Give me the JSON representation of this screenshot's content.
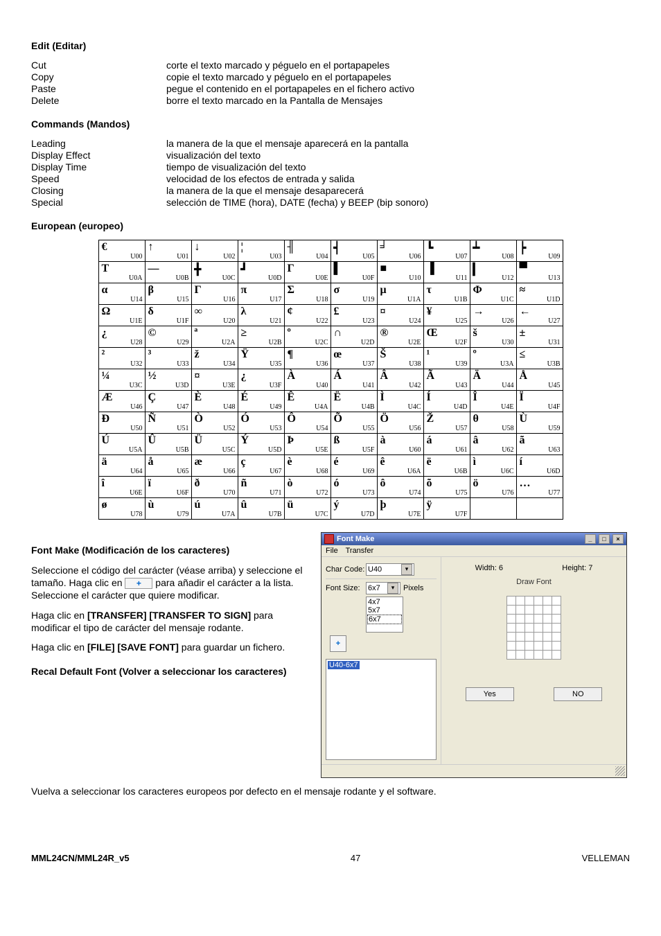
{
  "sections": {
    "edit": {
      "title": "Edit (Editar)",
      "items": [
        {
          "term": "Cut",
          "desc": "corte el texto marcado y péguelo en el portapapeles"
        },
        {
          "term": "Copy",
          "desc": "copie el texto marcado y péguelo en el portapapeles"
        },
        {
          "term": "Paste",
          "desc": "pegue el contenido en el portapapeles en el fichero activo"
        },
        {
          "term": "Delete",
          "desc": "borre el texto marcado en la Pantalla de Mensajes"
        }
      ]
    },
    "commands": {
      "title": "Commands (Mandos)",
      "items": [
        {
          "term": "Leading",
          "desc": "la manera de la que el mensaje aparecerá en la pantalla"
        },
        {
          "term": "Display Effect",
          "desc": "visualización del texto"
        },
        {
          "term": "Display Time",
          "desc": "tiempo de visualización del texto"
        },
        {
          "term": "Speed",
          "desc": "velocidad de los efectos de entrada y salida"
        },
        {
          "term": "Closing",
          "desc": "la manera de la que el mensaje desaparecerá"
        },
        {
          "term": "Special",
          "desc": "selección de TIME (hora), DATE (fecha) y BEEP (bip sonoro)"
        }
      ]
    },
    "european": {
      "title": "European (europeo)"
    },
    "fontmake": {
      "title": "Font Make (Modificación de los caracteres)",
      "p1a": "Seleccione el código del carácter (véase arriba) y seleccione el tamaño. Haga clic en ",
      "p1b": " para añadir el carácter a la lista. Seleccione el carácter que quiere modificar.",
      "p2a": "Haga clic en ",
      "p2b": "[TRANSFER] [TRANSFER TO SIGN]",
      "p2c": " para modificar el tipo de carácter del mensaje rodante.",
      "p3a": "Haga clic en ",
      "p3b": "[FILE] [SAVE FONT]",
      "p3c": " para guardar un fichero.",
      "recal_title": "Recal Default Font (Volver a seleccionar los caracteres)",
      "recal_p": "Vuelva a seleccionar los caracteres europeos por defecto en el mensaje rodante y el software."
    }
  },
  "glyph_rows": [
    [
      {
        "s": "€",
        "c": "U00"
      },
      {
        "s": "↑",
        "c": "U01"
      },
      {
        "s": "↓",
        "c": "U02"
      },
      {
        "s": "¦",
        "c": "U03"
      },
      {
        "s": "╢",
        "c": "U04"
      },
      {
        "s": "┥",
        "c": "U05"
      },
      {
        "s": "╛",
        "c": "U06"
      },
      {
        "s": "┗",
        "c": "U07"
      },
      {
        "s": "┷",
        "c": "U08"
      },
      {
        "s": "┝",
        "c": "U09"
      }
    ],
    [
      {
        "s": "Τ",
        "c": "U0A"
      },
      {
        "s": "―",
        "c": "U0B"
      },
      {
        "s": "╋",
        "c": "U0C"
      },
      {
        "s": "┛",
        "c": "U0D"
      },
      {
        "s": "Γ",
        "c": "U0E"
      },
      {
        "s": "▌",
        "c": "U0F"
      },
      {
        "s": "■",
        "c": "U10"
      },
      {
        "s": "▐",
        "c": "U11"
      },
      {
        "s": "▎",
        "c": "U12"
      },
      {
        "s": "▀",
        "c": "U13"
      }
    ],
    [
      {
        "s": "α",
        "c": "U14"
      },
      {
        "s": "β",
        "c": "U15"
      },
      {
        "s": "Γ",
        "c": "U16"
      },
      {
        "s": "π",
        "c": "U17"
      },
      {
        "s": "Σ",
        "c": "U18"
      },
      {
        "s": "σ",
        "c": "U19"
      },
      {
        "s": "μ",
        "c": "U1A"
      },
      {
        "s": "τ",
        "c": "U1B"
      },
      {
        "s": "Φ",
        "c": "U1C"
      },
      {
        "s": "≈",
        "c": "U1D"
      }
    ],
    [
      {
        "s": "Ω",
        "c": "U1E"
      },
      {
        "s": "δ",
        "c": "U1F"
      },
      {
        "s": "∞",
        "c": "U20"
      },
      {
        "s": "λ",
        "c": "U21"
      },
      {
        "s": "¢",
        "c": "U22"
      },
      {
        "s": "£",
        "c": "U23"
      },
      {
        "s": "¤",
        "c": "U24"
      },
      {
        "s": "¥",
        "c": "U25"
      },
      {
        "s": "→",
        "c": "U26"
      },
      {
        "s": "←",
        "c": "U27"
      }
    ],
    [
      {
        "s": "¿",
        "c": "U28"
      },
      {
        "s": "©",
        "c": "U29"
      },
      {
        "s": "ª",
        "c": "U2A"
      },
      {
        "s": "≥",
        "c": "U2B"
      },
      {
        "s": "º",
        "c": "U2C"
      },
      {
        "s": "∩",
        "c": "U2D"
      },
      {
        "s": "®",
        "c": "U2E"
      },
      {
        "s": "Œ",
        "c": "U2F"
      },
      {
        "s": "š",
        "c": "U30"
      },
      {
        "s": "±",
        "c": "U31"
      }
    ],
    [
      {
        "s": "²",
        "c": "U32"
      },
      {
        "s": "³",
        "c": "U33"
      },
      {
        "s": "ž",
        "c": "U34"
      },
      {
        "s": "Ÿ",
        "c": "U35"
      },
      {
        "s": "¶",
        "c": "U36"
      },
      {
        "s": "œ",
        "c": "U37"
      },
      {
        "s": "Š",
        "c": "U38"
      },
      {
        "s": "¹",
        "c": "U39"
      },
      {
        "s": "º",
        "c": "U3A"
      },
      {
        "s": "≤",
        "c": "U3B"
      }
    ],
    [
      {
        "s": "¼",
        "c": "U3C"
      },
      {
        "s": "½",
        "c": "U3D"
      },
      {
        "s": "¤",
        "c": "U3E"
      },
      {
        "s": "¿",
        "c": "U3F"
      },
      {
        "s": "À",
        "c": "U40"
      },
      {
        "s": "Á",
        "c": "U41"
      },
      {
        "s": "Â",
        "c": "U42"
      },
      {
        "s": "Ã",
        "c": "U43"
      },
      {
        "s": "Ä",
        "c": "U44"
      },
      {
        "s": "Å",
        "c": "U45"
      }
    ],
    [
      {
        "s": "Æ",
        "c": "U46"
      },
      {
        "s": "Ç",
        "c": "U47"
      },
      {
        "s": "È",
        "c": "U48"
      },
      {
        "s": "É",
        "c": "U49"
      },
      {
        "s": "Ê",
        "c": "U4A"
      },
      {
        "s": "Ë",
        "c": "U4B"
      },
      {
        "s": "Ì",
        "c": "U4C"
      },
      {
        "s": "Í",
        "c": "U4D"
      },
      {
        "s": "Î",
        "c": "U4E"
      },
      {
        "s": "Ï",
        "c": "U4F"
      }
    ],
    [
      {
        "s": "Ð",
        "c": "U50"
      },
      {
        "s": "Ñ",
        "c": "U51"
      },
      {
        "s": "Ò",
        "c": "U52"
      },
      {
        "s": "Ó",
        "c": "U53"
      },
      {
        "s": "Ô",
        "c": "U54"
      },
      {
        "s": "Õ",
        "c": "U55"
      },
      {
        "s": "Ö",
        "c": "U56"
      },
      {
        "s": "Ž",
        "c": "U57"
      },
      {
        "s": "θ",
        "c": "U58"
      },
      {
        "s": "Ù",
        "c": "U59"
      }
    ],
    [
      {
        "s": "Ú",
        "c": "U5A"
      },
      {
        "s": "Û",
        "c": "U5B"
      },
      {
        "s": "Ü",
        "c": "U5C"
      },
      {
        "s": "Ý",
        "c": "U5D"
      },
      {
        "s": "Þ",
        "c": "U5E"
      },
      {
        "s": "ß",
        "c": "U5F"
      },
      {
        "s": "à",
        "c": "U60"
      },
      {
        "s": "á",
        "c": "U61"
      },
      {
        "s": "â",
        "c": "U62"
      },
      {
        "s": "ã",
        "c": "U63"
      }
    ],
    [
      {
        "s": "ä",
        "c": "U64"
      },
      {
        "s": "å",
        "c": "U65"
      },
      {
        "s": "æ",
        "c": "U66"
      },
      {
        "s": "ç",
        "c": "U67"
      },
      {
        "s": "è",
        "c": "U68"
      },
      {
        "s": "é",
        "c": "U69"
      },
      {
        "s": "ê",
        "c": "U6A"
      },
      {
        "s": "ë",
        "c": "U6B"
      },
      {
        "s": "ì",
        "c": "U6C"
      },
      {
        "s": "í",
        "c": "U6D"
      }
    ],
    [
      {
        "s": "î",
        "c": "U6E"
      },
      {
        "s": "ï",
        "c": "U6F"
      },
      {
        "s": "ð",
        "c": "U70"
      },
      {
        "s": "ñ",
        "c": "U71"
      },
      {
        "s": "ò",
        "c": "U72"
      },
      {
        "s": "ó",
        "c": "U73"
      },
      {
        "s": "ô",
        "c": "U74"
      },
      {
        "s": "õ",
        "c": "U75"
      },
      {
        "s": "ö",
        "c": "U76"
      },
      {
        "s": "…",
        "c": "U77"
      }
    ],
    [
      {
        "s": "ø",
        "c": "U78"
      },
      {
        "s": "ù",
        "c": "U79"
      },
      {
        "s": "ú",
        "c": "U7A"
      },
      {
        "s": "û",
        "c": "U7B"
      },
      {
        "s": "ü",
        "c": "U7C"
      },
      {
        "s": "ý",
        "c": "U7D"
      },
      {
        "s": "þ",
        "c": "U7E"
      },
      {
        "s": "ÿ",
        "c": "U7F"
      },
      {
        "s": "",
        "c": ""
      },
      {
        "s": "",
        "c": ""
      }
    ]
  ],
  "window": {
    "title": "Font Make",
    "menu_file": "File",
    "menu_transfer": "Transfer",
    "charcode_label": "Char Code:",
    "charcode_value": "U40",
    "fontsize_label": "Font Size:",
    "fontsize_value": "6x7",
    "pixels_label": "Pixels",
    "list": [
      "4x7",
      "5x7",
      "6x7"
    ],
    "list_selected": "6x7",
    "tree_item": "U40-6x7",
    "width_label": "Width: 6",
    "height_label": "Height: 7",
    "draw_label": "Draw Font",
    "yes": "Yes",
    "no": "NO",
    "minimize": "_",
    "maximize": "□",
    "close": "×"
  },
  "footer": {
    "left": "MML24CN/MML24R_v5",
    "center": "47",
    "right": "VELLEMAN"
  }
}
